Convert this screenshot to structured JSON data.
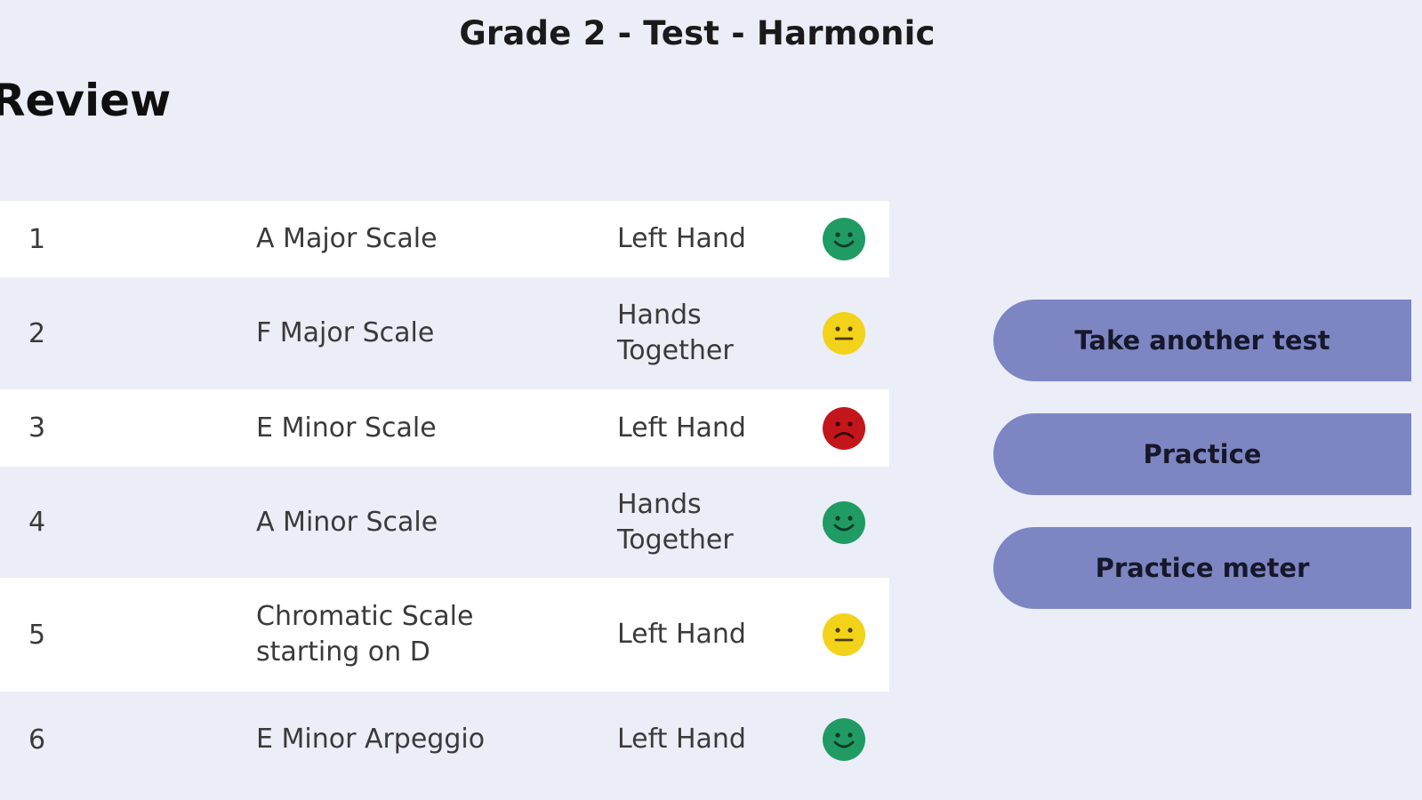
{
  "header": {
    "title": "Grade 2 - Test - Harmonic"
  },
  "review": {
    "heading": "Review"
  },
  "results": [
    {
      "number": "1",
      "name_line1": "A Major Scale",
      "name_line2": "",
      "hand_line1": "Left Hand",
      "hand_line2": "",
      "rating": "happy",
      "rating_color": "#1f9b63"
    },
    {
      "number": "2",
      "name_line1": "F Major Scale",
      "name_line2": "",
      "hand_line1": "Hands",
      "hand_line2": "Together",
      "rating": "neutral",
      "rating_color": "#f3d21a"
    },
    {
      "number": "3",
      "name_line1": "E Minor Scale",
      "name_line2": "",
      "hand_line1": "Left Hand",
      "hand_line2": "",
      "rating": "sad",
      "rating_color": "#c3161b"
    },
    {
      "number": "4",
      "name_line1": "A Minor Scale",
      "name_line2": "",
      "hand_line1": "Hands",
      "hand_line2": "Together",
      "rating": "happy",
      "rating_color": "#1f9b63"
    },
    {
      "number": "5",
      "name_line1": "Chromatic Scale",
      "name_line2": "starting on D",
      "hand_line1": "Left Hand",
      "hand_line2": "",
      "rating": "neutral",
      "rating_color": "#f3d21a"
    },
    {
      "number": "6",
      "name_line1": "E Minor Arpeggio",
      "name_line2": "",
      "hand_line1": "Left Hand",
      "hand_line2": "",
      "rating": "happy",
      "rating_color": "#1f9b63"
    }
  ],
  "actions": {
    "take_another_test": "Take another test",
    "practice": "Practice",
    "practice_meter": "Practice meter"
  },
  "colors": {
    "background": "#ebedf7",
    "row_light": "#ffffff",
    "button": "#7d86c3",
    "happy": "#1f9b63",
    "neutral": "#f3d21a",
    "sad": "#c3161b"
  },
  "icons": {
    "happy": "happy-face-icon",
    "neutral": "neutral-face-icon",
    "sad": "sad-face-icon"
  }
}
